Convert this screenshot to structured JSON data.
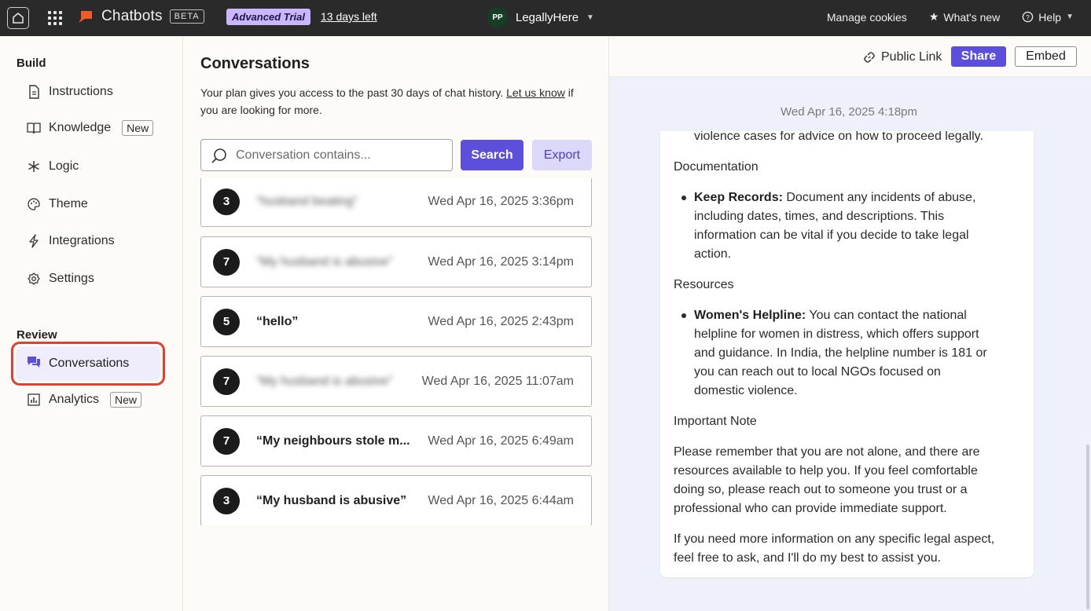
{
  "topbar": {
    "brand": "Chatbots",
    "beta": "BETA",
    "trial": "Advanced Trial",
    "days_left": "13 days left",
    "workspace_initials": "PP",
    "workspace_name": "LegallyHere",
    "manage_cookies": "Manage cookies",
    "whats_new": "What's new",
    "help": "Help"
  },
  "sidebar": {
    "build_title": "Build",
    "review_title": "Review",
    "items": {
      "instructions": "Instructions",
      "knowledge": "Knowledge",
      "knowledge_badge": "New",
      "logic": "Logic",
      "theme": "Theme",
      "integrations": "Integrations",
      "settings": "Settings",
      "conversations": "Conversations",
      "analytics": "Analytics",
      "analytics_badge": "New"
    }
  },
  "conversations": {
    "title": "Conversations",
    "desc_pre": "Your plan gives you access to the past 30 days of chat history. ",
    "desc_link": "Let us know",
    "desc_post": " if you are looking for more.",
    "search_placeholder": "Conversation contains...",
    "search_button": "Search",
    "export_button": "Export",
    "items": [
      {
        "count": "3",
        "text": "“husband beating”",
        "date": "Wed Apr 16, 2025 3:36pm",
        "blurred": true
      },
      {
        "count": "7",
        "text": "“My husband is abusive”",
        "date": "Wed Apr 16, 2025 3:14pm",
        "blurred": true
      },
      {
        "count": "5",
        "text": "“hello”",
        "date": "Wed Apr 16, 2025 2:43pm",
        "blurred": false
      },
      {
        "count": "7",
        "text": "“My husband is abusive”",
        "date": "Wed Apr 16, 2025 11:07am",
        "blurred": true
      },
      {
        "count": "7",
        "text": "“My neighbours stole m...",
        "date": "Wed Apr 16, 2025 6:49am",
        "blurred": false
      },
      {
        "count": "3",
        "text": "“My husband is abusive”",
        "date": "Wed Apr 16, 2025 6:44am",
        "blurred": false
      }
    ]
  },
  "panel": {
    "public_link": "Public Link",
    "share": "Share",
    "embed": "Embed",
    "timestamp": "Wed Apr 16, 2025 4:18pm",
    "message": {
      "line_top": "violence cases for advice on how to proceed legally.",
      "documentation": "Documentation",
      "keep_records_bold": "Keep Records:",
      "keep_records_l1": " Document any incidents of abuse,",
      "keep_records_l2": "including dates, times, and descriptions. This",
      "keep_records_l3": "information can be vital if you decide to take legal",
      "keep_records_l4": "action.",
      "resources": "Resources",
      "helpline_bold": "Women's Helpline:",
      "helpline_l1": " You can contact the national",
      "helpline_l2": "helpline for women in distress, which offers support",
      "helpline_l3": "and guidance. In India, the helpline number is 181 or",
      "helpline_l4": "you can reach out to local NGOs focused on",
      "helpline_l5": "domestic violence.",
      "important_note": "Important Note",
      "note_l1": "Please remember that you are not alone, and there are",
      "note_l2": "resources available to help you. If you feel comfortable",
      "note_l3": "doing so, please reach out to someone you trust or a",
      "note_l4": "professional who can provide immediate support.",
      "closing_l1": "If you need more information on any specific legal aspect,",
      "closing_l2": "feel free to ask, and I'll do my best to assist you."
    }
  },
  "colors": {
    "accent": "#5b4fdb",
    "highlight_outline": "#e0402d",
    "topbar": "#2a2a2a",
    "trial_badge": "#c9b6ff"
  },
  "icons": [
    "home-icon",
    "apps-grid-icon",
    "chatbots-logo-icon",
    "chevron-down-icon",
    "star-icon",
    "help-circle-icon",
    "document-icon",
    "book-icon",
    "asterisk-icon",
    "palette-icon",
    "lightning-icon",
    "gear-icon",
    "chat-bubbles-icon",
    "bar-chart-icon",
    "search-icon",
    "link-icon"
  ]
}
